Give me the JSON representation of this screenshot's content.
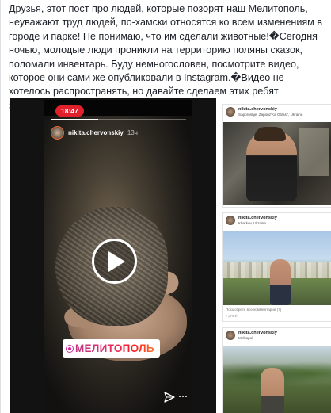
{
  "post": {
    "text": "Друзья, этот пост про людей, которые позорят наш Мелитополь, неуважают труд людей, по-хамски относятся ко всем изменениям в городе и парке! Не понимаю, что им сделали животные!�Сегодня ночью, молодые люди проникли на территорию поляны сказок, поломали инвентарь. Буду немногословен, посмотрите видео, которое они сами же опубликовали в Instagram.�Видео не хотелось распространять, но давайте сделаем этих ребят знаменитыми! Вот он герой."
  },
  "video": {
    "status_time": "18:47",
    "username": "nikita.chervonskiy",
    "time_ago": "13ч",
    "progress": 0.35,
    "location_sticker": "МЕЛИТОПОЛЬ",
    "play_icon": "play-icon",
    "send_icon": "send-icon"
  },
  "instagram_posts": [
    {
      "username": "nikita.chervonskiy",
      "location": "Saporoshje, Zaporiz'Ka Oblast', Ukraine"
    },
    {
      "username": "nikita.chervonskiy",
      "location": "Kharkov, Ukraine",
      "caption": "Посмотреть все комментарии (7)",
      "time": "7 ДНЕЙ"
    },
    {
      "username": "nikita.chervonskiy",
      "location": "Melitopol"
    }
  ],
  "colors": {
    "recording_pill": "#e0202a",
    "instagram_gradient_start": "#c13584",
    "instagram_gradient_end": "#f77737",
    "page_background": "#e9ebee"
  }
}
